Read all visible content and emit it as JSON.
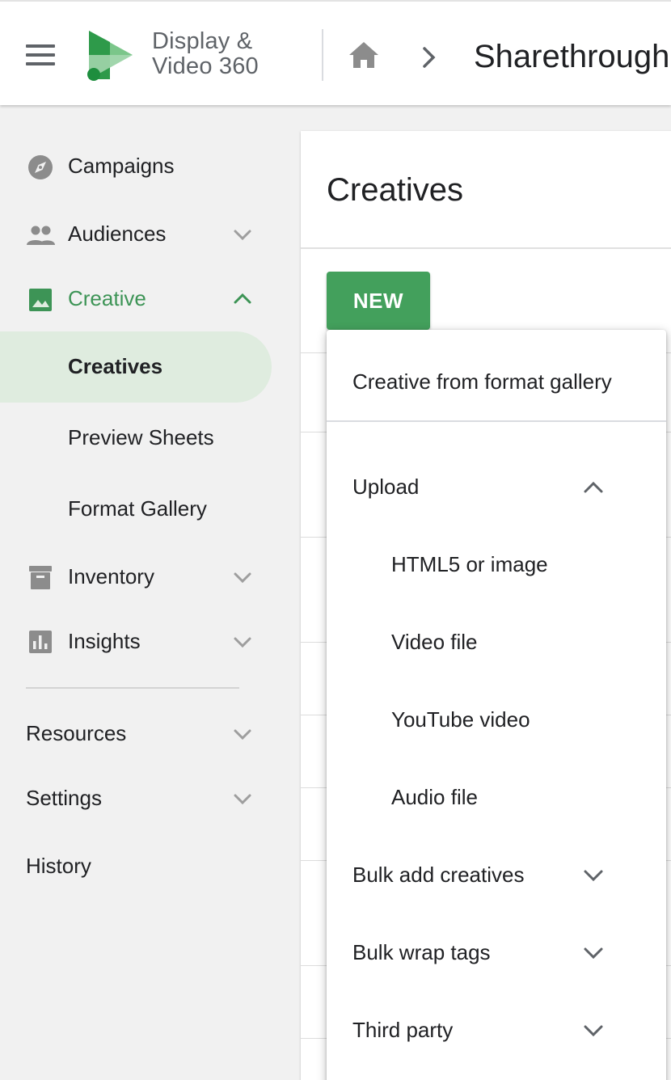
{
  "header": {
    "menu_icon": "hamburger-menu-icon",
    "product_line1": "Display &",
    "product_line2": "Video 360",
    "home_icon": "home-icon",
    "breadcrumb_separator_icon": "chevron-right-icon",
    "partner_name": "Sharethrough"
  },
  "sidebar": {
    "items": [
      {
        "label": "Campaigns",
        "icon": "compass-icon"
      },
      {
        "label": "Audiences",
        "icon": "people-icon",
        "expand_icon": "chevron-down-icon"
      },
      {
        "label": "Creative",
        "icon": "image-icon",
        "expand_icon": "chevron-up-icon"
      },
      {
        "label": "Inventory",
        "icon": "archive-box-icon",
        "expand_icon": "chevron-down-icon"
      },
      {
        "label": "Insights",
        "icon": "bar-chart-icon",
        "expand_icon": "chevron-down-icon"
      }
    ],
    "creative_children": [
      "Creatives",
      "Preview Sheets",
      "Format Gallery"
    ],
    "selected": "Creatives",
    "bottom_items": [
      "Resources",
      "Settings",
      "History"
    ]
  },
  "main": {
    "title": "Creatives",
    "new_button": "NEW"
  },
  "new_menu": {
    "format_gallery": "Creative from format gallery",
    "upload": {
      "label": "Upload",
      "expanded": true,
      "children": [
        "HTML5 or image",
        "Video file",
        "YouTube video",
        "Audio file"
      ]
    },
    "bulk_add": "Bulk add creatives",
    "bulk_wrap": "Bulk wrap tags",
    "third_party": "Third party"
  },
  "colors": {
    "accent_green": "#43a05c",
    "active_text": "#3d9456",
    "selected_bg": "#dfecdf",
    "icon_grey": "#8c8c8c"
  }
}
